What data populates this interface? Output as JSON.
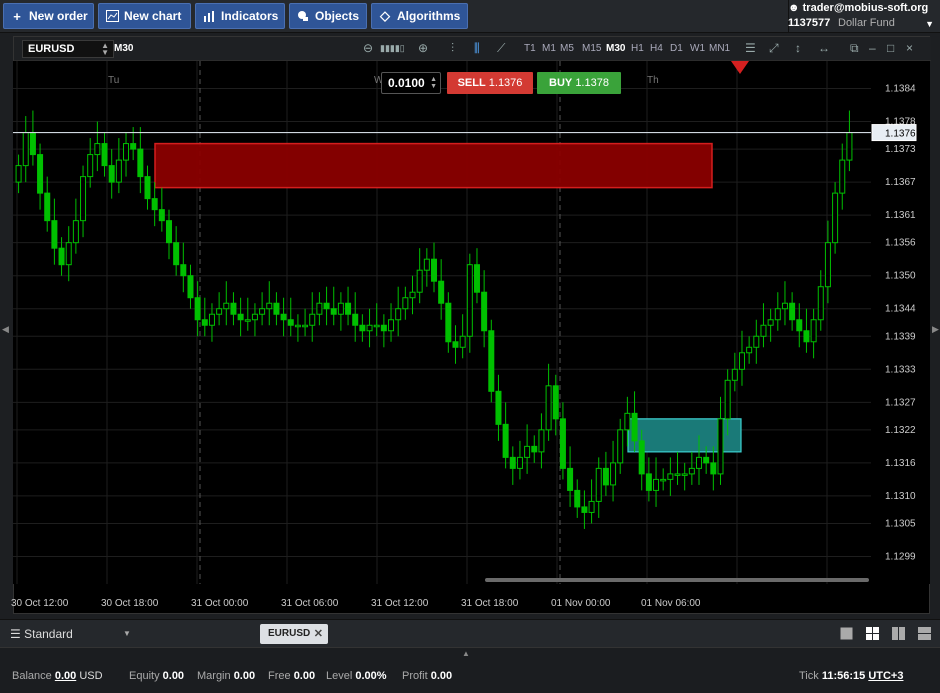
{
  "toolbar": {
    "new_order": "New order",
    "new_chart": "New chart",
    "indicators": "Indicators",
    "objects": "Objects",
    "algorithms": "Algorithms"
  },
  "account": {
    "user": "trader@mobius-soft.org",
    "number": "1137577",
    "fund": "Dollar Fund"
  },
  "chart": {
    "symbol": "EURUSD",
    "timeframe": "M30",
    "timeframes": [
      "T1",
      "M1",
      "M5",
      "M15",
      "M30",
      "H1",
      "H4",
      "D1",
      "W1",
      "MN1"
    ],
    "active_timeframe": "M30",
    "day_labels": [
      "Tu",
      "W",
      "Th"
    ],
    "lot": "0.0100",
    "sell_label": "SELL",
    "sell_price": "1.1376",
    "buy_label": "BUY",
    "buy_price": "1.1378",
    "current_price": "1.1376",
    "y_ticks": [
      "1.1384",
      "1.1378",
      "1.1373",
      "1.1367",
      "1.1361",
      "1.1356",
      "1.1350",
      "1.1344",
      "1.1339",
      "1.1333",
      "1.1327",
      "1.1322",
      "1.1316",
      "1.1310",
      "1.1305",
      "1.1299"
    ],
    "x_ticks": [
      "30 Oct 12:00",
      "30 Oct 18:00",
      "31 Oct 00:00",
      "31 Oct 06:00",
      "31 Oct 12:00",
      "31 Oct 18:00",
      "01 Nov 00:00",
      "01 Nov 06:00"
    ],
    "colors": {
      "up": "#00c000",
      "down": "#00c000",
      "supply_zone": "#8b0000",
      "demand_zone": "#1a7a78",
      "price_line": "#d0d8e0"
    }
  },
  "chart_data": {
    "type": "candlestick",
    "symbol": "EURUSD",
    "timeframe": "M30",
    "ylim": [
      1.1294,
      1.1389
    ],
    "close_series": [
      1.137,
      1.1376,
      1.1372,
      1.1365,
      1.136,
      1.1355,
      1.1352,
      1.1356,
      1.136,
      1.1368,
      1.1372,
      1.1374,
      1.137,
      1.1367,
      1.1371,
      1.1374,
      1.1373,
      1.1368,
      1.1364,
      1.1362,
      1.136,
      1.1356,
      1.1352,
      1.135,
      1.1346,
      1.1342,
      1.1341,
      1.1343,
      1.1344,
      1.1345,
      1.1343,
      1.1342,
      1.1342,
      1.1343,
      1.1344,
      1.1345,
      1.1343,
      1.1342,
      1.1341,
      1.1341,
      1.1341,
      1.1343,
      1.1345,
      1.1344,
      1.1343,
      1.1345,
      1.1343,
      1.1341,
      1.134,
      1.1341,
      1.1341,
      1.134,
      1.1342,
      1.1344,
      1.1346,
      1.1347,
      1.1351,
      1.1353,
      1.1349,
      1.1345,
      1.1338,
      1.1337,
      1.1339,
      1.1352,
      1.1347,
      1.134,
      1.1329,
      1.1323,
      1.1317,
      1.1315,
      1.1317,
      1.1319,
      1.1318,
      1.1322,
      1.133,
      1.1324,
      1.1315,
      1.1311,
      1.1308,
      1.1307,
      1.1309,
      1.1315,
      1.1312,
      1.1316,
      1.1322,
      1.1325,
      1.132,
      1.1314,
      1.1311,
      1.1313,
      1.1313,
      1.1314,
      1.1314,
      1.1314,
      1.1315,
      1.1317,
      1.1316,
      1.1314,
      1.1324,
      1.1331,
      1.1333,
      1.1336,
      1.1337,
      1.1339,
      1.1341,
      1.1342,
      1.1344,
      1.1345,
      1.1342,
      1.134,
      1.1338,
      1.1342,
      1.1348,
      1.1356,
      1.1365,
      1.1371,
      1.1376
    ]
  }
}
